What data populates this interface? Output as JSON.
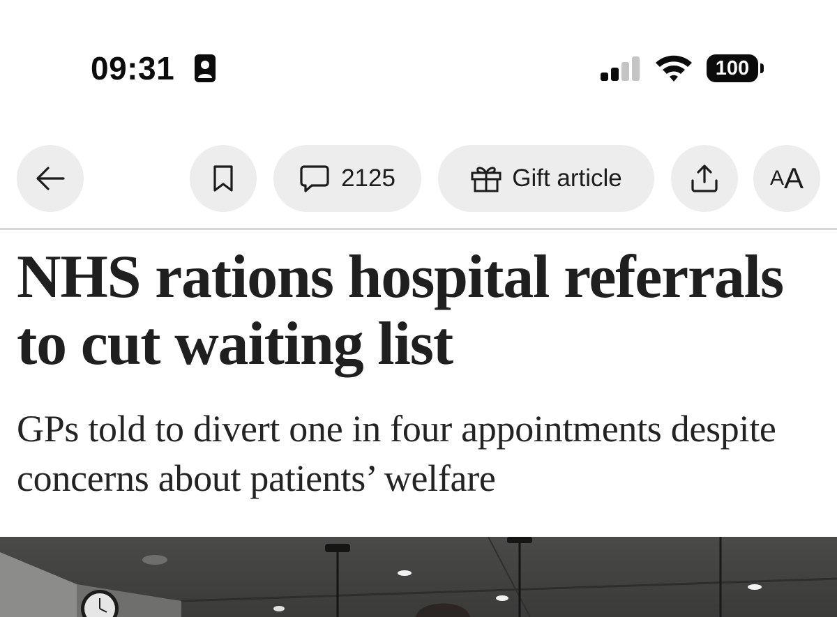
{
  "status_bar": {
    "time": "09:31",
    "battery_level": "100",
    "signal_bars_active": 2,
    "signal_bars_total": 4,
    "icons": [
      "contact-badge-icon",
      "cellular-signal-icon",
      "wifi-icon",
      "battery-icon"
    ]
  },
  "toolbar": {
    "back_icon": "arrow-left-icon",
    "bookmark_icon": "bookmark-icon",
    "comments_icon": "speech-bubble-icon",
    "comments_count": "2125",
    "gift_icon": "gift-icon",
    "gift_label": "Gift article",
    "share_icon": "share-icon",
    "text_size_small": "A",
    "text_size_large": "A"
  },
  "article": {
    "headline": "NHS rations hospital referrals to cut waiting list",
    "subheadline": "GPs told to divert one in four appointments despite concerns about patients’ welfare"
  },
  "colors": {
    "pill_background": "#ededed",
    "text_primary": "#1f1f1f",
    "divider": "#d9d9d9"
  }
}
